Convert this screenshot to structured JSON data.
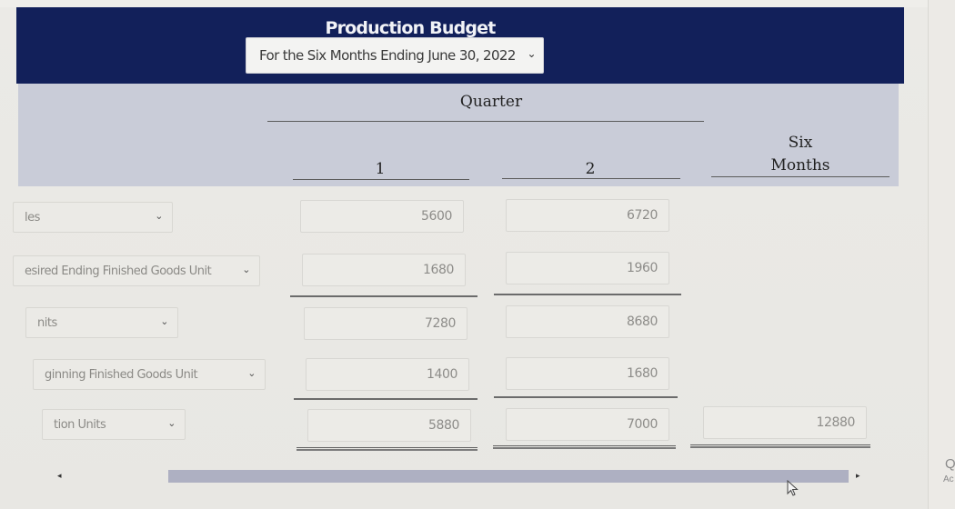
{
  "header": {
    "title": "Production Budget",
    "period": {
      "selected": "For the Six Months Ending June 30, 2022",
      "icon": "chevron-down-icon"
    }
  },
  "columns": {
    "group_label": "Quarter",
    "q1": "1",
    "q2": "2",
    "total_line1": "Six",
    "total_line2": "Months"
  },
  "rows": [
    {
      "label": "Sales",
      "visible_label": "les",
      "q1": "5600",
      "q2": "6720",
      "total": ""
    },
    {
      "label": "Desired Ending Finished Goods Unit",
      "visible_label": "esired Ending Finished Goods Unit",
      "q1": "1680",
      "q2": "1960",
      "total": ""
    },
    {
      "label": "Total Required Units",
      "visible_label": "nits",
      "q1": "7280",
      "q2": "8680",
      "total": ""
    },
    {
      "label": "Beginning Finished Goods Unit",
      "visible_label": "ginning Finished Goods Unit",
      "q1": "1400",
      "q2": "1680",
      "total": ""
    },
    {
      "label": "Required Production Units",
      "visible_label": "tion Units",
      "q1": "5880",
      "q2": "7000",
      "total": "12880"
    }
  ],
  "scrollbar": {
    "left_arrow": "◂",
    "right_arrow": "▸"
  },
  "edge_glyphs": [
    "Q",
    "Ac"
  ],
  "colors": {
    "header_bg": "#12205a",
    "column_header_bg": "#c9ccd8",
    "page_bg": "#ebeae6"
  }
}
